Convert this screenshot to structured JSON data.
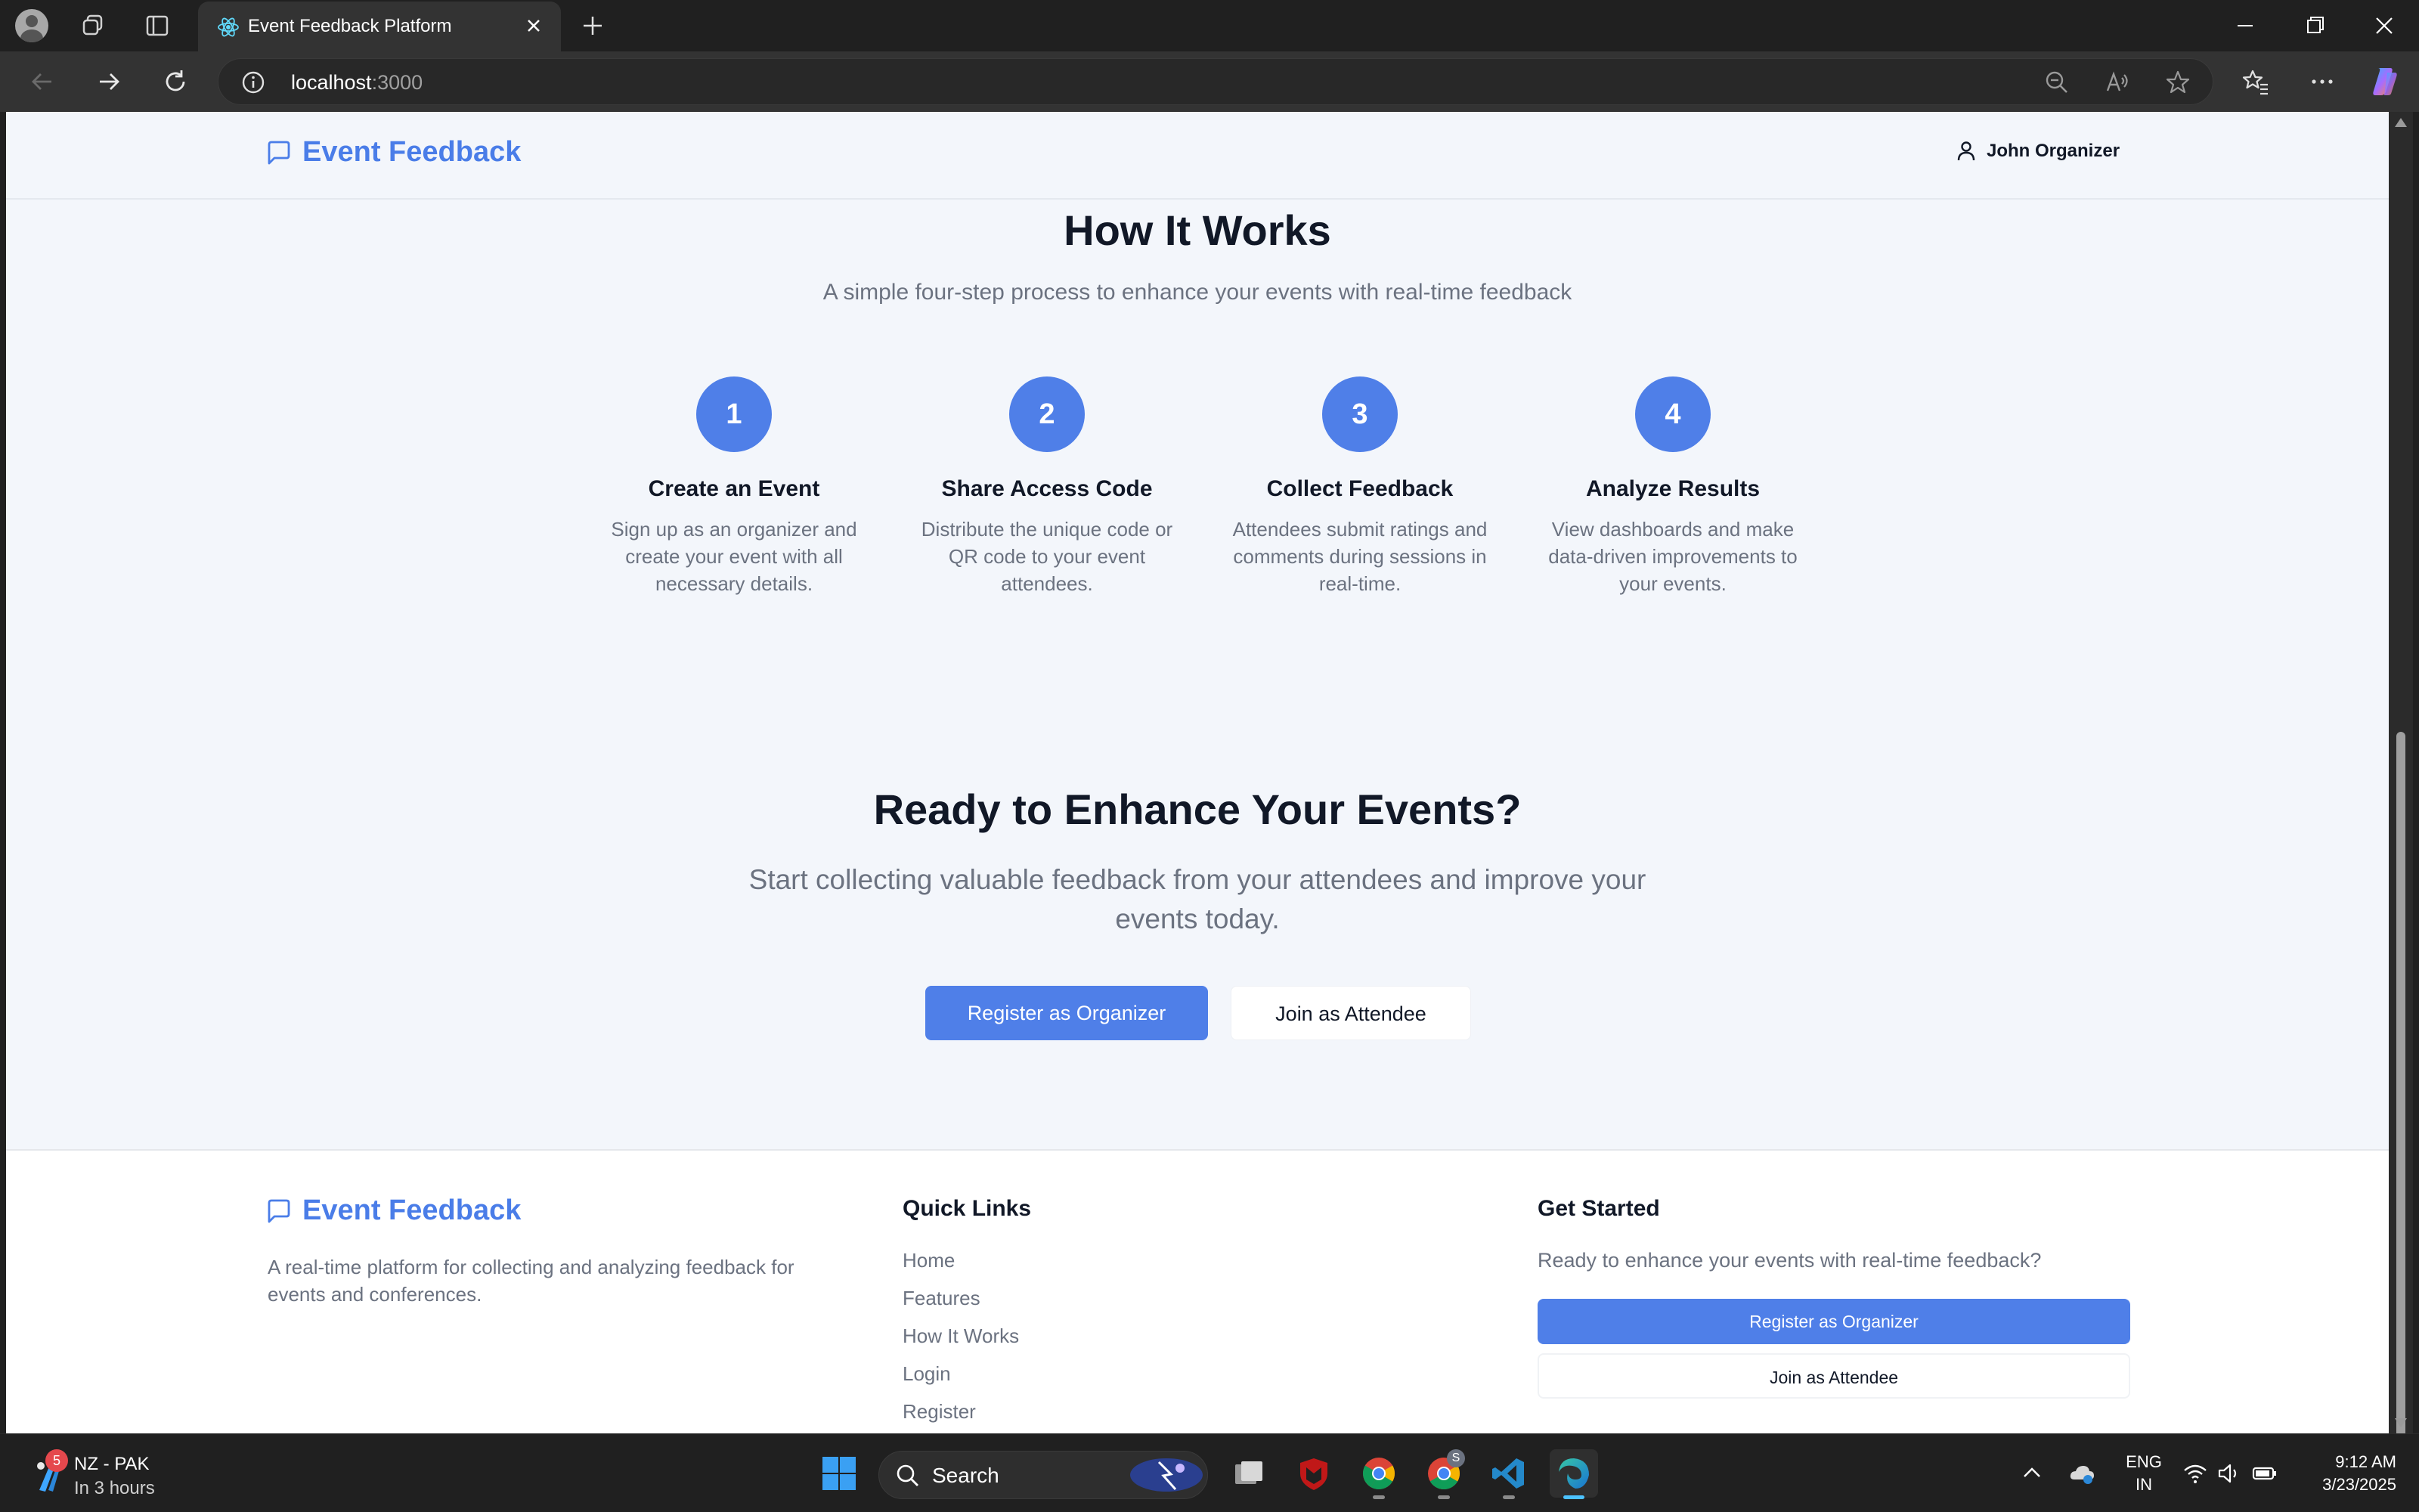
{
  "browser": {
    "tab_title": "Event Feedback Platform",
    "url_host": "localhost",
    "url_port": ":3000"
  },
  "header": {
    "logo_text": "Event Feedback",
    "user_name": "John Organizer"
  },
  "how_it_works": {
    "title": "How It Works",
    "subtitle": "A simple four-step process to enhance your events with real-time feedback",
    "steps": [
      {
        "number": "1",
        "title": "Create an Event",
        "description": "Sign up as an organizer and create your event with all necessary details."
      },
      {
        "number": "2",
        "title": "Share Access Code",
        "description": "Distribute the unique code or QR code to your event attendees."
      },
      {
        "number": "3",
        "title": "Collect Feedback",
        "description": "Attendees submit ratings and comments during sessions in real-time."
      },
      {
        "number": "4",
        "title": "Analyze Results",
        "description": "View dashboards and make data-driven improvements to your events."
      }
    ]
  },
  "cta": {
    "title": "Ready to Enhance Your Events?",
    "subtitle": "Start collecting valuable feedback from your attendees and improve your events today.",
    "primary_button": "Register as Organizer",
    "secondary_button": "Join as Attendee"
  },
  "footer": {
    "logo_text": "Event Feedback",
    "description": "A real-time platform for collecting and analyzing feedback for events and conferences.",
    "quick_links_heading": "Quick Links",
    "quick_links": [
      "Home",
      "Features",
      "How It Works",
      "Login",
      "Register"
    ],
    "get_started_heading": "Get Started",
    "get_started_text": "Ready to enhance your events with real-time feedback?",
    "register_button": "Register as Organizer",
    "join_button": "Join as Attendee"
  },
  "taskbar": {
    "weather_badge": "5",
    "weather_title": "NZ - PAK",
    "weather_subtitle": "In 3 hours",
    "search_label": "Search",
    "chrome_badge": "S",
    "lang_line1": "ENG",
    "lang_line2": "IN",
    "time": "9:12 AM",
    "date": "3/23/2025"
  },
  "colors": {
    "accent": "#4f7fe8",
    "logo_blue": "#4a7de8",
    "page_bg": "#f3f6fb",
    "chrome_dark": "#202020"
  }
}
